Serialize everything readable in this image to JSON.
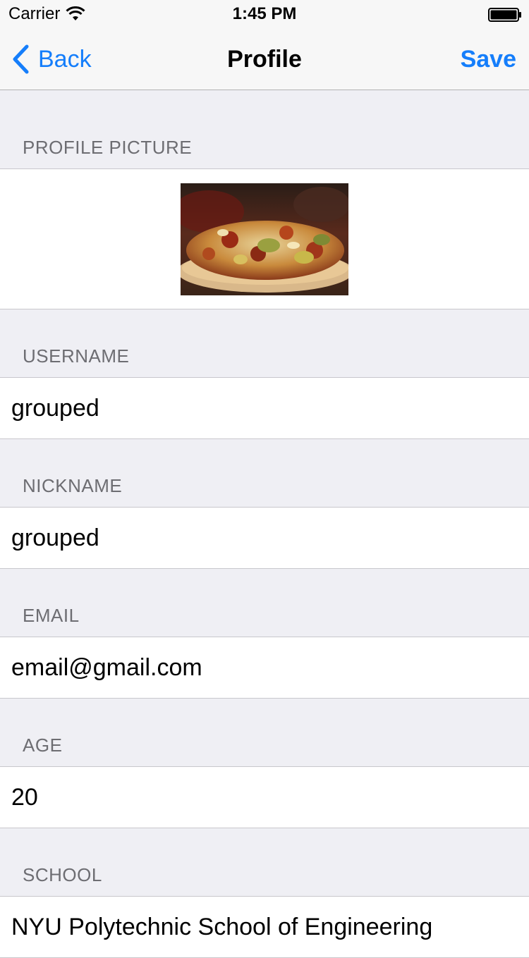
{
  "status_bar": {
    "carrier": "Carrier",
    "time": "1:45 PM"
  },
  "nav": {
    "back_label": "Back",
    "title": "Profile",
    "save_label": "Save"
  },
  "colors": {
    "accent": "#157efb",
    "background": "#efeff4",
    "header_text": "#6d6d72"
  },
  "sections": {
    "profile_picture": {
      "header": "PROFILE PICTURE",
      "image": "pizza-photo"
    },
    "username": {
      "header": "USERNAME",
      "value": "grouped"
    },
    "nickname": {
      "header": "NICKNAME",
      "value": "grouped"
    },
    "email": {
      "header": "EMAIL",
      "value": "email@gmail.com"
    },
    "age": {
      "header": "AGE",
      "value": "20"
    },
    "school": {
      "header": "SCHOOL",
      "value": "NYU Polytechnic School of Engineering"
    }
  }
}
